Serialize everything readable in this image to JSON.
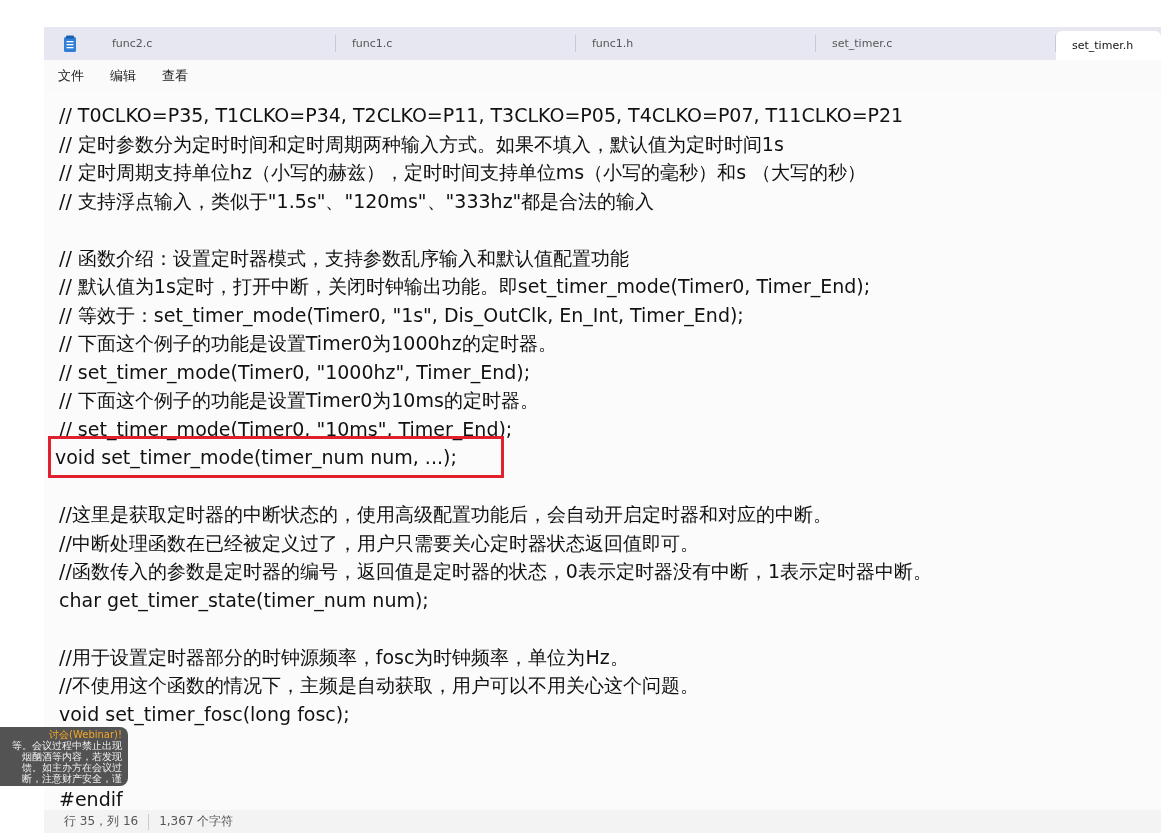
{
  "tabs": [
    {
      "label": "func2.c",
      "selected": false
    },
    {
      "label": "func1.c",
      "selected": false
    },
    {
      "label": "func1.h",
      "selected": false
    },
    {
      "label": "set_timer.c",
      "selected": false
    },
    {
      "label": "set_timer.h",
      "selected": true
    }
  ],
  "menu": [
    "文件",
    "编辑",
    "查看"
  ],
  "lines": [
    {
      "text": "// T0CLKO=P35, T1CLKO=P34, T2CLKO=P11, T3CLKO=P05, T4CLKO=P07, T11CLKO=P21",
      "highlighted": false
    },
    {
      "text": "// 定时参数分为定时时间和定时周期两种输入方式。如果不填入，默认值为定时时间1s",
      "highlighted": false
    },
    {
      "text": "// 定时周期支持单位hz（小写的赫兹），定时时间支持单位ms（小写的毫秒）和s （大写的秒）",
      "highlighted": false
    },
    {
      "text": "// 支持浮点输入，类似于\"1.5s\"、\"120ms\"、\"333hz\"都是合法的输入",
      "highlighted": false
    },
    {
      "kind": "blank"
    },
    {
      "text": "// 函数介绍：设置定时器模式，支持参数乱序输入和默认值配置功能",
      "highlighted": false
    },
    {
      "text": "// 默认值为1s定时，打开中断，关闭时钟输出功能。即set_timer_mode(Timer0, Timer_End);",
      "highlighted": false
    },
    {
      "text": "// 等效于：set_timer_mode(Timer0, \"1s\", Dis_OutClk, En_Int, Timer_End);",
      "highlighted": false
    },
    {
      "text": "// 下面这个例子的功能是设置Timer0为1000hz的定时器。",
      "highlighted": false
    },
    {
      "text": "// set_timer_mode(Timer0, \"1000hz\", Timer_End);",
      "highlighted": false
    },
    {
      "text": "// 下面这个例子的功能是设置Timer0为10ms的定时器。",
      "highlighted": false
    },
    {
      "text": "// set_timer_mode(Timer0, \"10ms\", Timer_End);",
      "highlighted": false
    },
    {
      "text": "void set_timer_mode(timer_num num, ...);",
      "highlighted": true
    },
    {
      "kind": "blank"
    },
    {
      "text": "//这里是获取定时器的中断状态的，使用高级配置功能后，会自动开启定时器和对应的中断。",
      "highlighted": false
    },
    {
      "text": "//中断处理函数在已经被定义过了，用户只需要关心定时器状态返回值即可。",
      "highlighted": false
    },
    {
      "text": "//函数传入的参数是定时器的编号，返回值是定时器的状态，0表示定时器没有中断，1表示定时器中断。",
      "highlighted": false
    },
    {
      "text": "char get_timer_state(timer_num num);",
      "highlighted": false
    },
    {
      "kind": "blank"
    },
    {
      "text": "//用于设置定时器部分的时钟源频率，fosc为时钟频率，单位为Hz。",
      "highlighted": false
    },
    {
      "text": "//不使用这个函数的情况下，主频是自动获取，用户可以不用关心这个问题。",
      "highlighted": false
    },
    {
      "text": "void set_timer_fosc(long fosc);",
      "highlighted": false
    },
    {
      "kind": "blank"
    },
    {
      "kind": "blank"
    },
    {
      "text": "#endif",
      "highlighted": false
    }
  ],
  "status_bar": {
    "position": "行 35，列 16",
    "characters": "1,367 个字符"
  },
  "notification": {
    "title": "讨会(Webinar)!",
    "lines": [
      "等。会议过程中禁止出现",
      "烟酗酒等内容，若发现",
      "馈。如主办方在会议过",
      "断，注意财产安全，谨"
    ]
  }
}
